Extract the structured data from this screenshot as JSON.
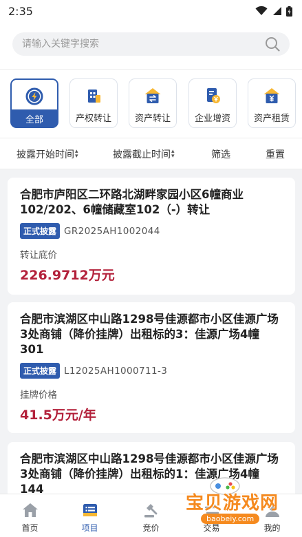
{
  "status": {
    "time": "2:35"
  },
  "search": {
    "placeholder": "请输入关键字搜索"
  },
  "categories": [
    {
      "label": "全部",
      "icon": "lightning-icon",
      "active": true
    },
    {
      "label": "产权转让",
      "icon": "building-icon",
      "active": false
    },
    {
      "label": "资产转让",
      "icon": "house-exchange-icon",
      "active": false
    },
    {
      "label": "企业增资",
      "icon": "document-yuan-icon",
      "active": false
    },
    {
      "label": "资产租赁",
      "icon": "house-yuan-icon",
      "active": false
    }
  ],
  "filters": {
    "start_time": "披露开始时间",
    "end_time": "披露截止时间",
    "screen": "筛选",
    "reset": "重置"
  },
  "listings": [
    {
      "title": "合肥市庐阳区二环路北湖畔家园小区6幢商业102/202、6幢储藏室102（-）转让",
      "tag": "正式披露",
      "code": "GR2025AH1002044",
      "price_label": "转让底价",
      "price": "226.9712万元"
    },
    {
      "title": "合肥市滨湖区中山路1298号佳源都市小区佳源广场3处商铺（降价挂牌）出租标的3：佳源广场4幢301",
      "tag": "正式披露",
      "code": "L12025AH1000711-3",
      "price_label": "挂牌价格",
      "price": "41.5万元/年"
    },
    {
      "title": "合肥市滨湖区中山路1298号佳源都市小区佳源广场3处商铺（降价挂牌）出租标的1：佳源广场4幢144"
    }
  ],
  "tabbar": [
    {
      "label": "首页",
      "icon": "home-icon",
      "active": false
    },
    {
      "label": "项目",
      "icon": "project-icon",
      "active": true
    },
    {
      "label": "竞价",
      "icon": "auction-icon",
      "active": false
    },
    {
      "label": "交易",
      "icon": "trade-icon",
      "active": false
    },
    {
      "label": "我的",
      "icon": "profile-icon",
      "active": false
    }
  ],
  "watermark": {
    "text": "宝贝游戏网",
    "url": "baobeiy.com"
  },
  "colors": {
    "primary": "#2f5cae",
    "price": "#b3213b",
    "accent_orange": "#f58a1f"
  }
}
